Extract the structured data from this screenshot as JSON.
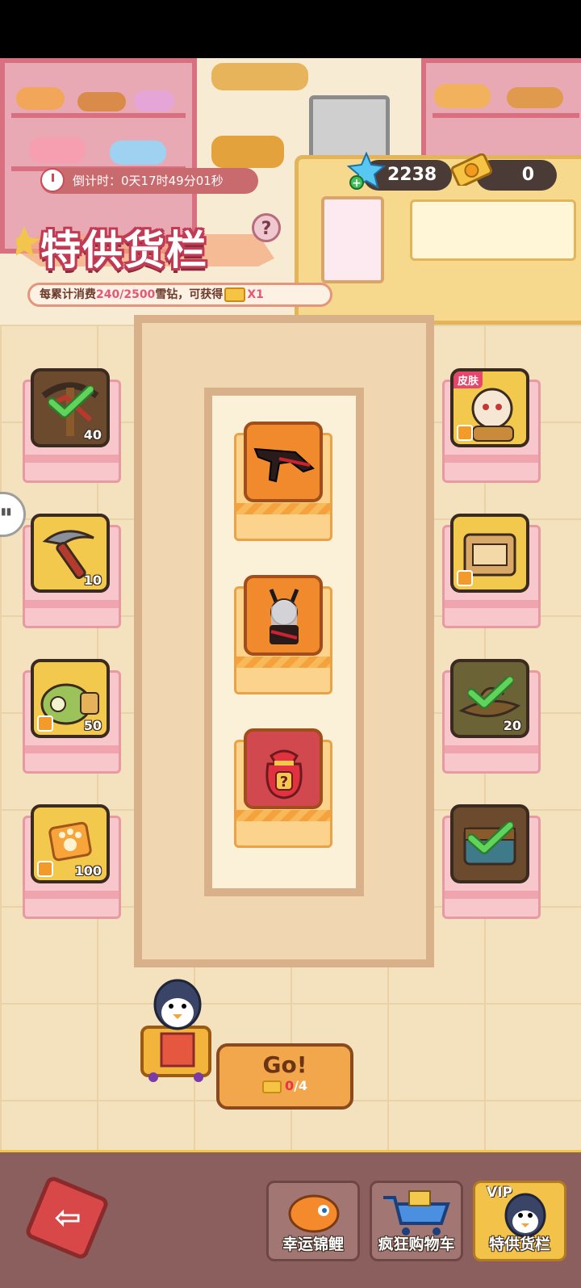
{
  "hud": {
    "countdown": "倒计时：0天17时49分01秒",
    "gems": "2238",
    "tickets": "0"
  },
  "header": {
    "title": "特供货栏",
    "help": "?",
    "progress_prefix": "每累计消费",
    "progress_value": "240/2500",
    "progress_mid": "雪钻，可获得",
    "progress_reward": "X1"
  },
  "left_items": [
    {
      "name": "crossbow",
      "qty": "40",
      "claimed": true
    },
    {
      "name": "pickaxe",
      "qty": "10",
      "claimed": false
    },
    {
      "name": "frog-pack",
      "qty": "50",
      "claimed": false
    },
    {
      "name": "paw-token",
      "qty": "100",
      "claimed": false
    }
  ],
  "right_items": [
    {
      "name": "monkey-king-skin",
      "badge": "皮肤",
      "qty": "",
      "claimed": false
    },
    {
      "name": "booth-decor",
      "qty": "",
      "claimed": false
    },
    {
      "name": "hat",
      "qty": "20",
      "claimed": true
    },
    {
      "name": "chest",
      "qty": "",
      "claimed": true
    }
  ],
  "center_items": [
    {
      "name": "demon-weapon"
    },
    {
      "name": "demon-skin"
    },
    {
      "name": "mystery-bag",
      "glyph": "?"
    }
  ],
  "go_button": {
    "label": "Go!",
    "count_have": "0",
    "count_total": "/4"
  },
  "tabs": [
    {
      "label": "幸运锦鲤",
      "active": false
    },
    {
      "label": "疯狂购物车",
      "active": false
    },
    {
      "label": "特供货栏",
      "active": true,
      "badge": "VIP"
    }
  ],
  "colors": {
    "accent_pink": "#e5577a",
    "gold": "#f3c94d",
    "bottom_bar": "#8a5f5e"
  }
}
